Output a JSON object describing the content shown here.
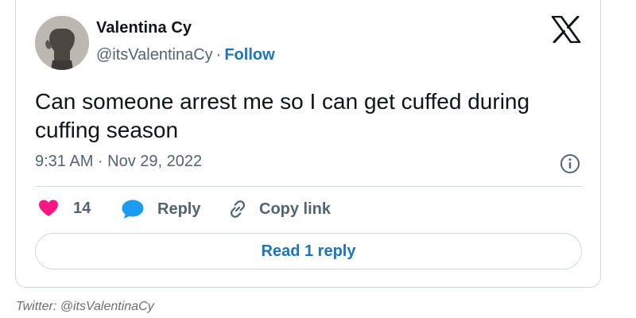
{
  "tweet": {
    "author_name": "Valentina Cy",
    "handle": "@itsValentinaCy",
    "separator": "·",
    "follow_label": "Follow",
    "text": "Can someone arrest me so I can get cuffed during cuffing season",
    "timestamp": "9:31 AM · Nov 29, 2022",
    "like_count": "14",
    "reply_label": "Reply",
    "copy_link_label": "Copy link",
    "read_replies_label": "Read 1 reply"
  },
  "caption": "Twitter: @itsValentinaCy",
  "icons": {
    "brand": "x-logo-icon",
    "info": "info-icon",
    "like": "heart-icon",
    "reply": "speech-bubble-icon",
    "copy": "link-icon"
  },
  "colors": {
    "link_blue": "#1d74bd",
    "heart_pink": "#f91880",
    "reply_blue": "#1d9bf0",
    "secondary_text": "#536471",
    "border": "#cfd9de"
  }
}
